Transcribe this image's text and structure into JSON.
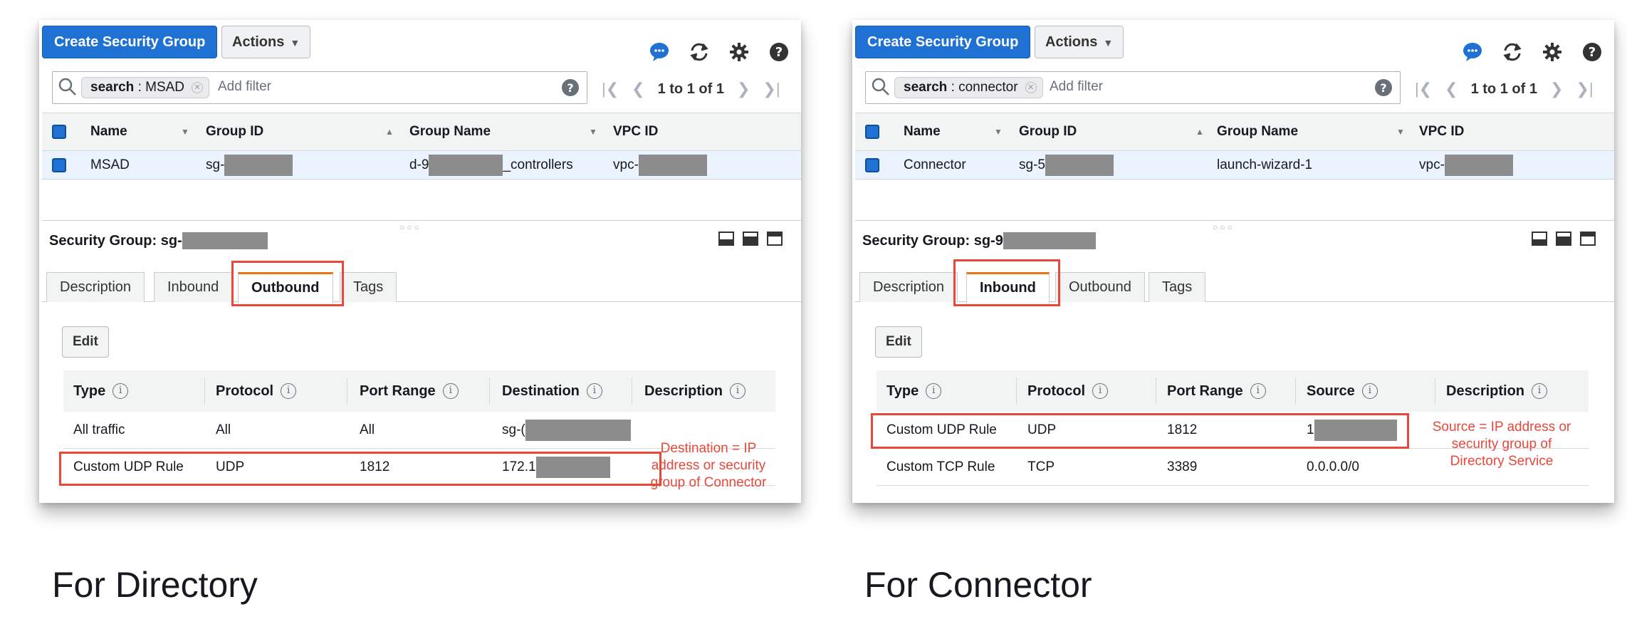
{
  "panels": [
    {
      "id": "directory",
      "create_button": "Create Security Group",
      "actions_button": "Actions",
      "filter_chip_key": "search",
      "filter_chip_value": ": MSAD",
      "add_filter": "Add filter",
      "pager_text": "1 to 1 of 1",
      "grid_columns": [
        "Name",
        "Group ID",
        "Group Name",
        "VPC ID"
      ],
      "grid_row": {
        "name": "MSAD",
        "group_id_prefix": "sg-",
        "group_name_prefix": "d-9",
        "group_name_suffix": "_controllers",
        "vpc_prefix": "vpc-"
      },
      "sg_title": "Security Group: sg-",
      "tabs": [
        "Description",
        "Inbound",
        "Outbound",
        "Tags"
      ],
      "active_tab": "Outbound",
      "edit_button": "Edit",
      "rules_columns": [
        "Type",
        "Protocol",
        "Port Range",
        "Destination",
        "Description"
      ],
      "rules": [
        {
          "type": "All traffic",
          "protocol": "All",
          "port_range": "All",
          "target": "sg-("
        },
        {
          "type": "Custom UDP Rule",
          "protocol": "UDP",
          "port_range": "1812",
          "target": "172.1"
        }
      ],
      "note": "Destination = IP\naddress or security\ngroup of Connector",
      "caption": "For Directory"
    },
    {
      "id": "connector",
      "create_button": "Create Security Group",
      "actions_button": "Actions",
      "filter_chip_key": "search",
      "filter_chip_value": ": connector",
      "add_filter": "Add filter",
      "pager_text": "1 to 1 of 1",
      "grid_columns": [
        "Name",
        "Group ID",
        "Group Name",
        "VPC ID"
      ],
      "grid_row": {
        "name": "Connector",
        "group_id_prefix": "sg-5",
        "group_name_prefix": "launch-wizard-1",
        "group_name_suffix": "",
        "vpc_prefix": "vpc-"
      },
      "sg_title": "Security Group: sg-9",
      "tabs": [
        "Description",
        "Inbound",
        "Outbound",
        "Tags"
      ],
      "active_tab": "Inbound",
      "edit_button": "Edit",
      "rules_columns": [
        "Type",
        "Protocol",
        "Port Range",
        "Source",
        "Description"
      ],
      "rules": [
        {
          "type": "Custom UDP Rule",
          "protocol": "UDP",
          "port_range": "1812",
          "target": "1"
        },
        {
          "type": "Custom TCP Rule",
          "protocol": "TCP",
          "port_range": "3389",
          "target": "0.0.0.0/0"
        }
      ],
      "note": "Source = IP address or\nsecurity group of\nDirectory Service",
      "caption": "For Connector"
    }
  ],
  "colors": {
    "primary_button": "#1f72d3",
    "highlight": "#e8473b",
    "active_tab_accent": "#ec7211",
    "redaction": "#8c8c8c"
  },
  "icons": [
    "chat-icon",
    "refresh-icon",
    "settings-gear-icon",
    "help-icon",
    "search-icon",
    "first-page-icon",
    "prev-page-icon",
    "next-page-icon",
    "last-page-icon"
  ]
}
